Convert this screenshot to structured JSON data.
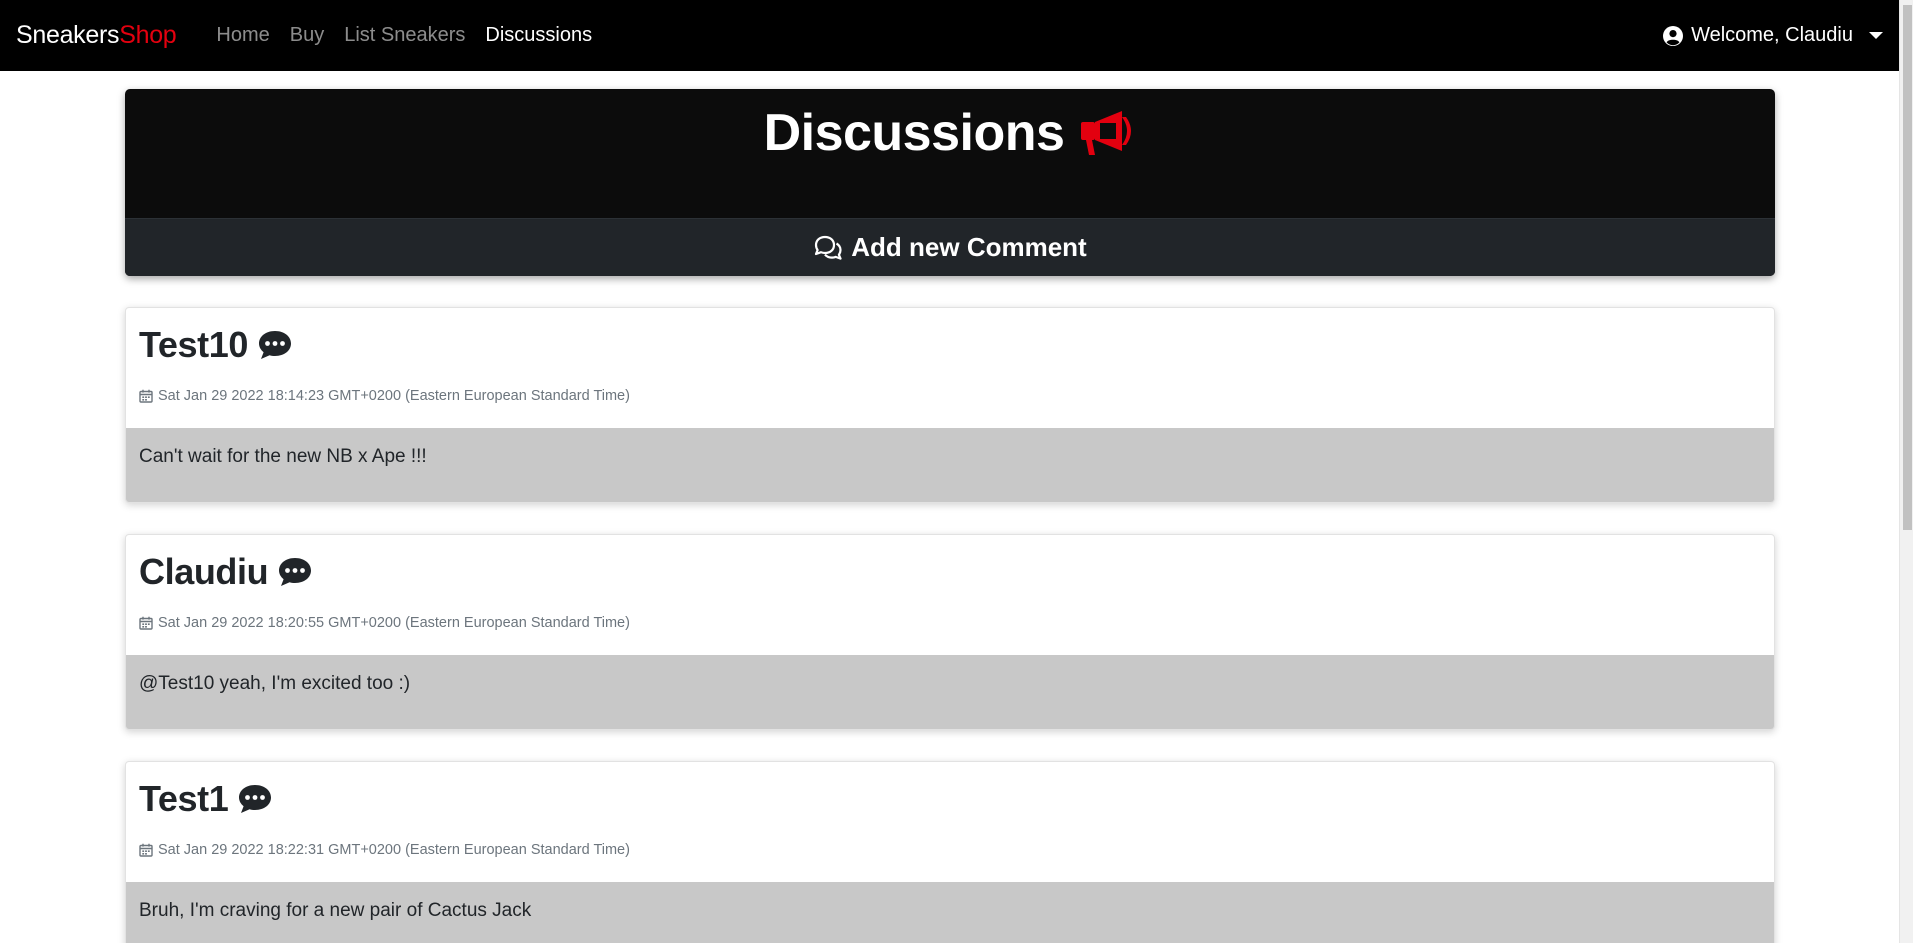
{
  "navbar": {
    "brand_main": "Sneakers",
    "brand_accent": "Shop",
    "links": [
      {
        "label": "Home",
        "active": false
      },
      {
        "label": "Buy",
        "active": false
      },
      {
        "label": "List Sneakers",
        "active": false
      },
      {
        "label": "Discussions",
        "active": true
      }
    ],
    "user_label": "Welcome, Claudiu",
    "user_icon": "user-circle-icon",
    "menu_icon": "caret-down-icon"
  },
  "header": {
    "title": "Discussions",
    "title_icon": "megaphone-icon",
    "add_comment_label": "Add new Comment",
    "add_comment_icon": "comments-icon"
  },
  "comments": [
    {
      "author": "Test10",
      "date": "Sat Jan 29 2022 18:14:23 GMT+0200 (Eastern European Standard Time)",
      "text": "Can't wait for the new NB x Ape !!!"
    },
    {
      "author": "Claudiu",
      "date": "Sat Jan 29 2022 18:20:55 GMT+0200 (Eastern European Standard Time)",
      "text": "@Test10 yeah, I'm excited too :)"
    },
    {
      "author": "Test1",
      "date": "Sat Jan 29 2022 18:22:31 GMT+0200 (Eastern European Standard Time)",
      "text": "Bruh, I'm craving for a new pair of Cactus Jack"
    }
  ],
  "colors": {
    "accent": "#e3000f",
    "navbar_bg": "#000000",
    "header_bg": "#0c0c0c",
    "add_comment_bg": "#212529",
    "comment_body_bg": "#c8c8c8"
  }
}
